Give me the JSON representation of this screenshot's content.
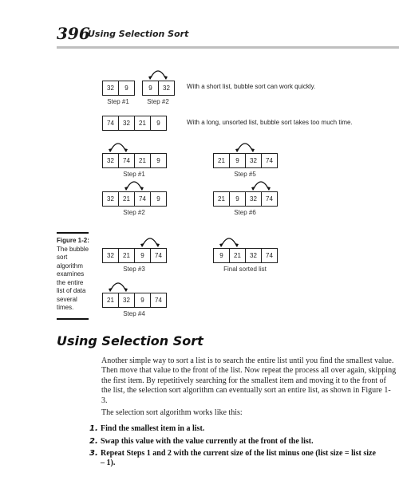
{
  "header": {
    "page_number": "396",
    "running_title": "Using Selection Sort"
  },
  "figure": {
    "short_list": {
      "steps": [
        {
          "label": "Step #1",
          "values": [
            "32",
            "9"
          ],
          "swap_arrow": null
        },
        {
          "label": "Step #2",
          "values": [
            "9",
            "32"
          ],
          "swap_arrow": [
            0,
            1
          ]
        }
      ],
      "note": "With a short list, bubble sort can work quickly."
    },
    "long_list": {
      "values": [
        "74",
        "32",
        "21",
        "9"
      ],
      "note": "With a long, unsorted list, bubble sort takes too much time."
    },
    "steps_left": [
      {
        "label": "Step #1",
        "values": [
          "32",
          "74",
          "21",
          "9"
        ],
        "swap_arrow": [
          0,
          1
        ]
      },
      {
        "label": "Step #2",
        "values": [
          "32",
          "21",
          "74",
          "9"
        ],
        "swap_arrow": [
          1,
          2
        ]
      },
      {
        "label": "Step #3",
        "values": [
          "32",
          "21",
          "9",
          "74"
        ],
        "swap_arrow": [
          2,
          3
        ]
      },
      {
        "label": "Step #4",
        "values": [
          "21",
          "32",
          "9",
          "74"
        ],
        "swap_arrow": [
          0,
          1
        ]
      }
    ],
    "steps_right": [
      {
        "label": "Step #5",
        "values": [
          "21",
          "9",
          "32",
          "74"
        ],
        "swap_arrow": [
          1,
          2
        ]
      },
      {
        "label": "Step #6",
        "values": [
          "21",
          "9",
          "32",
          "74"
        ],
        "swap_arrow": [
          2,
          3
        ]
      },
      {
        "label": "Final sorted list",
        "values": [
          "9",
          "21",
          "32",
          "74"
        ],
        "swap_arrow": [
          0,
          1
        ]
      }
    ],
    "caption": {
      "label": "Figure 1-2:",
      "text": "The bubble sort algorithm examines the entire list of data several times."
    }
  },
  "section": {
    "heading": "Using Selection Sort",
    "paragraph1": "Another simple way to sort a list is to search the entire list until you find the smallest value. Then move that value to the front of the list. Now repeat the process all over again, skipping the first item. By repetitively searching for the smallest item and moving it to the front of the list, the selection sort algorithm can eventually sort an entire list, as shown in Figure 1-3.",
    "paragraph2": "The selection sort algorithm works like this:",
    "steps": [
      {
        "number": "1.",
        "text": "Find the smallest item in a list."
      },
      {
        "number": "2.",
        "text": "Swap this value with the value currently at the front of the list."
      },
      {
        "number": "3.",
        "text": "Repeat Steps 1 and 2 with the current size of the list minus one (list size = list size – 1)."
      }
    ]
  }
}
